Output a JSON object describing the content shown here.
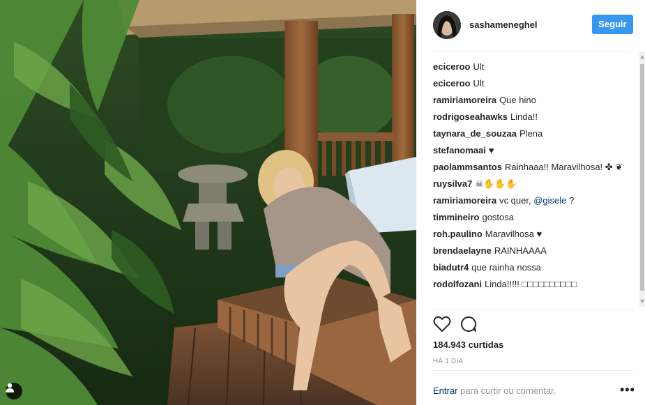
{
  "post": {
    "username": "sashameneghel",
    "follow_label": "Seguir",
    "likes_text": "184.943 curtidas",
    "timestamp": "HÁ 1 DIA",
    "login_link": "Entrar",
    "login_suffix": "para curtir ou comentar.",
    "more_label": "•••"
  },
  "comments": [
    {
      "user": "eciceroo",
      "text": "Ult"
    },
    {
      "user": "eciceroo",
      "text": "Ult"
    },
    {
      "user": "ramiriamoreira",
      "text": "Que hino"
    },
    {
      "user": "rodrigoseahawks",
      "text": "Linda!!"
    },
    {
      "user": "taynara_de_souzaa",
      "text": "Plena"
    },
    {
      "user": "stefanomaai",
      "text": "♥"
    },
    {
      "user": "paolammsantos",
      "text": "Rainhaaa!! Maravilhosa! ✤ ❦"
    },
    {
      "user": "ruysilva7",
      "text": "☠✋✋✋"
    },
    {
      "user": "ramiriamoreira",
      "text": "vc quer,",
      "mention": "@gisele",
      "after": "?"
    },
    {
      "user": "timmineiro",
      "text": "gostosa"
    },
    {
      "user": "roh.paulino",
      "text": "Maravilhosa ♥"
    },
    {
      "user": "brendaelayne",
      "text": "RAINHAAAA"
    },
    {
      "user": "biadutr4",
      "text": "que rainha nossa"
    },
    {
      "user": "rodolfozani",
      "text": "Linda!!!!! □□□□□□□□□□"
    }
  ],
  "icons": {
    "like": "heart-icon",
    "comment": "comment-icon",
    "user_tag": "user-tag-icon"
  },
  "colors": {
    "accent": "#3897f0",
    "link": "#003569",
    "muted": "#999999"
  }
}
